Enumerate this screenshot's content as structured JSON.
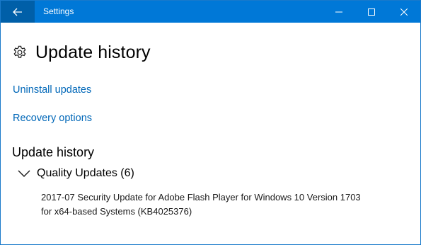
{
  "window": {
    "title": "Settings",
    "accent_color": "#0078d7"
  },
  "header": {
    "icon": "gear-icon",
    "title": "Update history"
  },
  "links": {
    "uninstall": "Uninstall updates",
    "recovery": "Recovery options"
  },
  "history": {
    "heading": "Update history",
    "groups": [
      {
        "label": "Quality Updates (6)",
        "expanded": true,
        "items": [
          {
            "line1": "2017-07 Security Update for Adobe Flash Player for Windows 10 Version 1703",
            "line2": "for x64-based Systems (KB4025376)"
          }
        ]
      }
    ]
  }
}
